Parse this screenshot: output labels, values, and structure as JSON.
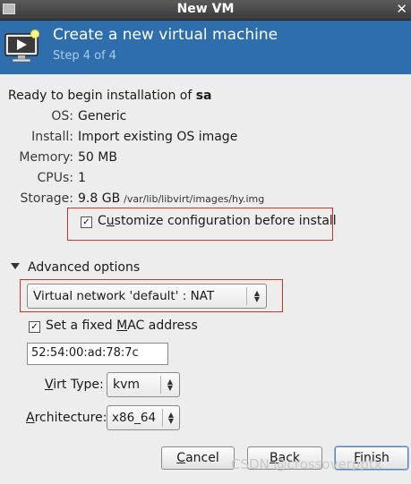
{
  "window": {
    "title": "New VM"
  },
  "header": {
    "title": "Create a new virtual machine",
    "step": "Step 4 of 4"
  },
  "summary": {
    "ready_prefix": "Ready to begin installation of ",
    "vm_name": "sa",
    "rows": [
      {
        "label": "OS:",
        "value": "Generic"
      },
      {
        "label": "Install:",
        "value": "Import existing OS image"
      },
      {
        "label": "Memory:",
        "value": "50 MB"
      },
      {
        "label": "CPUs:",
        "value": "1"
      },
      {
        "label": "Storage:",
        "value": "9.8 GB",
        "path": "/var/lib/libvirt/images/hy.img"
      }
    ]
  },
  "customize": {
    "checked": true,
    "label_pre": "C",
    "label_u": "u",
    "label_post": "stomize configuration before install"
  },
  "advanced": {
    "title": "Advanced options",
    "network": "Virtual network 'default' : NAT",
    "mac_checkbox": {
      "checked": true,
      "pre": "Set a fixed ",
      "u": "M",
      "post": "AC address"
    },
    "mac_value": "52:54:00:ad:78:7c",
    "virt_type": {
      "label_u": "V",
      "label_post": "irt Type:",
      "value": "kvm"
    },
    "architecture": {
      "label_u": "A",
      "label_post": "rchitecture:",
      "value": "x86_64"
    }
  },
  "buttons": {
    "cancel": {
      "u": "C",
      "post": "ancel"
    },
    "back": {
      "u": "B",
      "post": "ack"
    },
    "finish": {
      "u": "F",
      "post": "inish"
    }
  },
  "watermark": "CSDN @crossoverpptx",
  "colors": {
    "header_bg": "#2f6eac",
    "highlight_box": "#d0342c"
  }
}
